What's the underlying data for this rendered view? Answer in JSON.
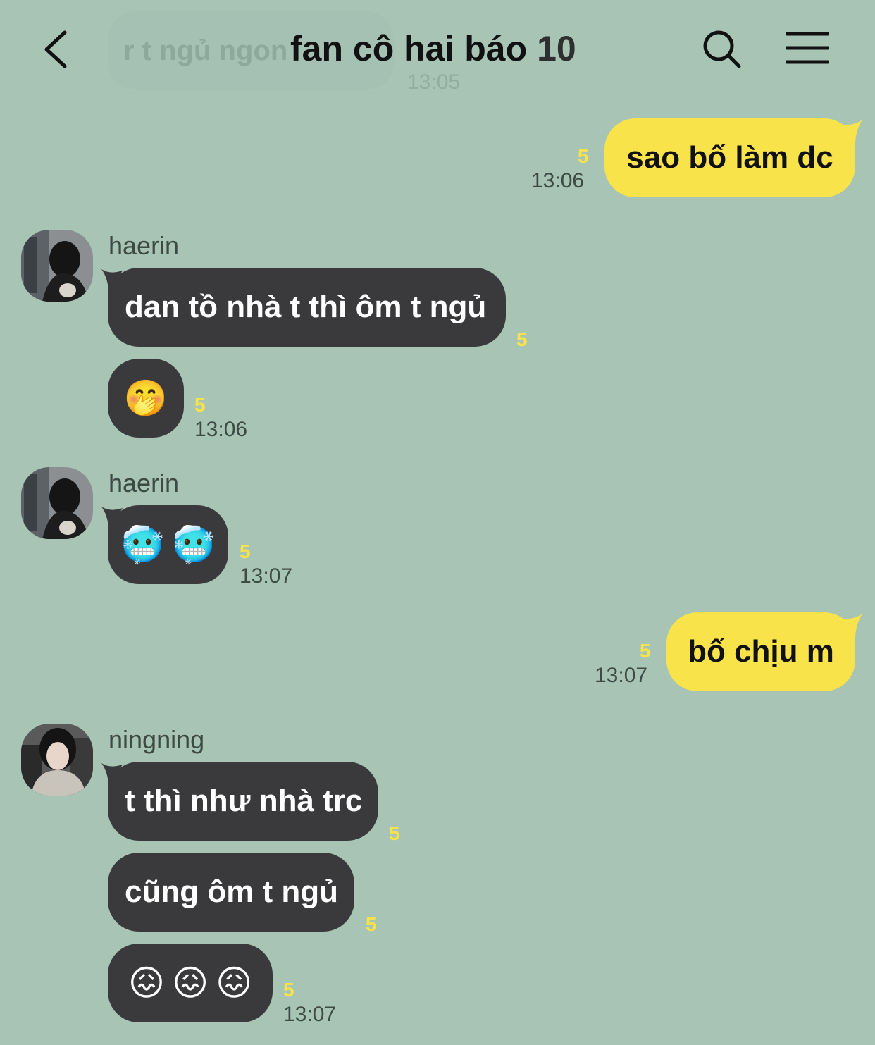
{
  "header": {
    "title": "fan cô hai báo",
    "member_count": "10",
    "faded_prev_message": "r t ngủ ngon",
    "faded_prev_time": "13:05"
  },
  "messages": {
    "m1": {
      "text": "sao bố làm dc",
      "unread": "5",
      "time": "13:06"
    },
    "m2": {
      "sender": "haerin",
      "text": "dan tồ nhà t thì ôm t ngủ",
      "unread": "5"
    },
    "m3": {
      "emoji": "🤭",
      "unread": "5",
      "time": "13:06"
    },
    "m4": {
      "sender": "haerin",
      "emoji1": "🥶",
      "emoji2": "🥶",
      "unread": "5",
      "time": "13:07"
    },
    "m5": {
      "text": "bố chịu m",
      "unread": "5",
      "time": "13:07"
    },
    "m6": {
      "sender": "ningning",
      "text": "t thì như nhà trc",
      "unread": "5"
    },
    "m7": {
      "text": "cũng ôm t ngủ",
      "unread": "5"
    },
    "m8": {
      "emoji1": "😖",
      "emoji2": "😖",
      "emoji3": "😖",
      "unread": "5",
      "time": "13:07"
    }
  },
  "colors": {
    "background": "#a7c4b5",
    "my_bubble": "#f9e34b",
    "their_bubble": "#3a3a3c",
    "unread_count": "#f9e34b"
  },
  "icons": {
    "back": "chevron-left-icon",
    "search": "search-icon",
    "menu": "hamburger-menu-icon"
  }
}
